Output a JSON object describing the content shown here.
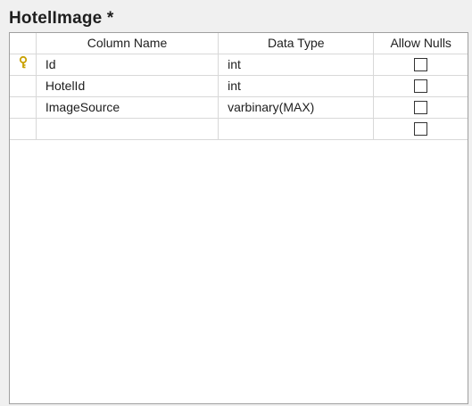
{
  "title": "HotelImage *",
  "columns": {
    "name": "Column Name",
    "type": "Data Type",
    "nulls": "Allow Nulls"
  },
  "rows": [
    {
      "name": "Id",
      "type": "int",
      "allow_nulls": false,
      "primary_key": true
    },
    {
      "name": "HotelId",
      "type": "int",
      "allow_nulls": false,
      "primary_key": false
    },
    {
      "name": "ImageSource",
      "type": "varbinary(MAX)",
      "allow_nulls": false,
      "primary_key": false
    },
    {
      "name": "",
      "type": "",
      "allow_nulls": false,
      "primary_key": false
    }
  ],
  "colors": {
    "key_icon": "#c8a000",
    "grid_line": "#d8d8d8",
    "frame_border": "#a0a0a0"
  },
  "icons": {
    "primary_key": "key-icon"
  }
}
